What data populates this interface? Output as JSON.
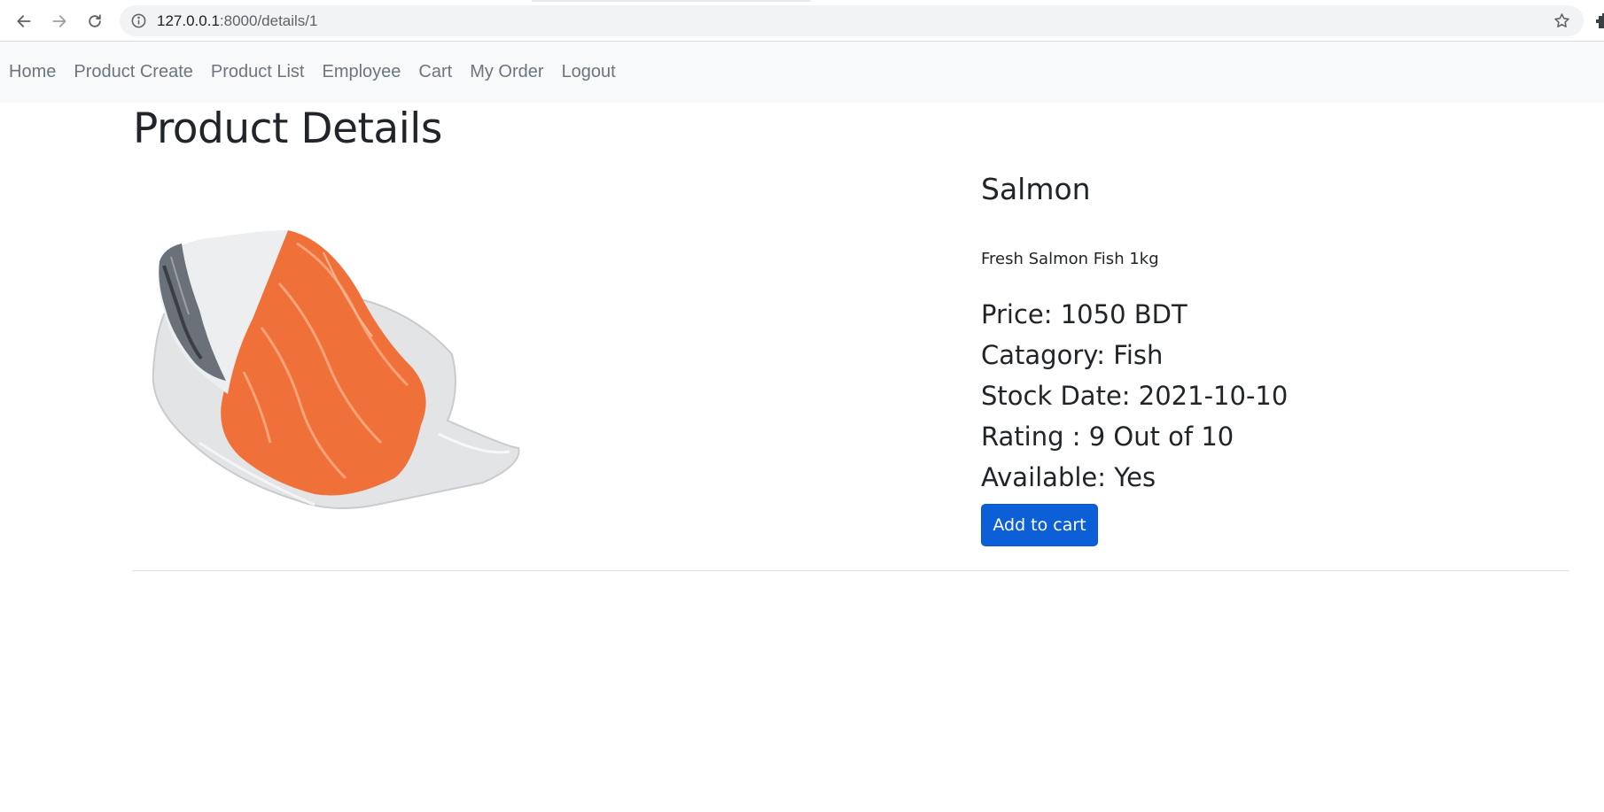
{
  "browser": {
    "url_host": "127.0.0.1",
    "url_path": ":8000/details/1"
  },
  "nav": {
    "items": [
      {
        "label": "Home"
      },
      {
        "label": "Product Create"
      },
      {
        "label": "Product List"
      },
      {
        "label": "Employee"
      },
      {
        "label": "Cart"
      },
      {
        "label": "My Order"
      },
      {
        "label": "Logout"
      }
    ]
  },
  "page": {
    "title": "Product Details"
  },
  "product": {
    "name": "Salmon",
    "description": "Fresh Salmon Fish 1kg",
    "price": "Price: 1050 BDT",
    "category": "Catagory: Fish",
    "stock_date": "Stock Date: 2021-10-10",
    "rating": "Rating : 9 Out of 10",
    "available": "Available: Yes",
    "add_to_cart_label": "Add to cart"
  },
  "colors": {
    "primary_button": "#0d5fd8",
    "navbar_bg": "#f8f9fa",
    "nav_link": "#6c757d",
    "text": "#212529"
  }
}
